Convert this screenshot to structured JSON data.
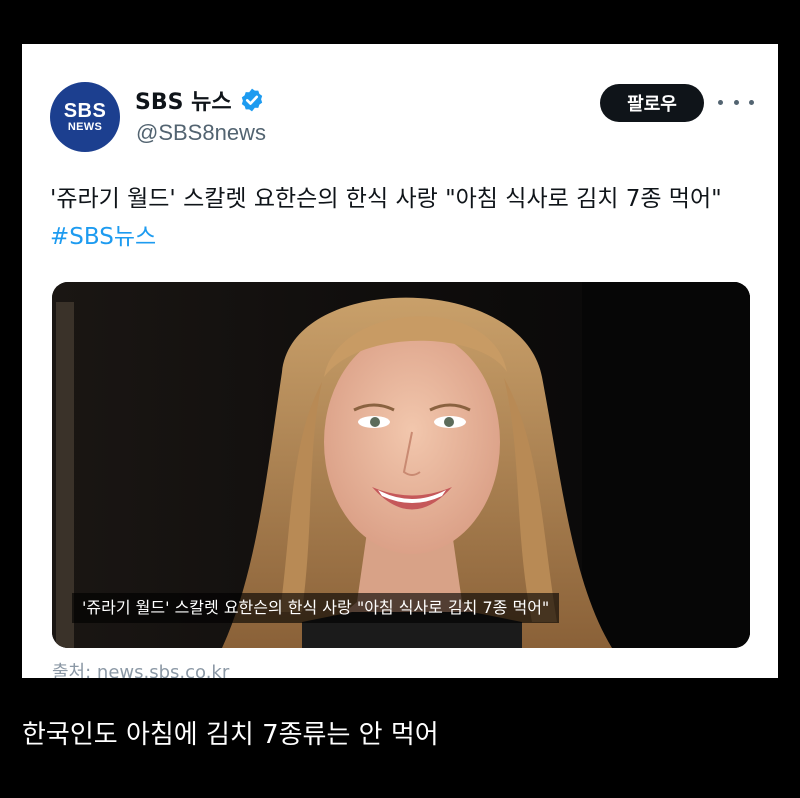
{
  "post": {
    "avatar_line1": "SBS",
    "avatar_line2": "NEWS",
    "account_name": "SBS 뉴스",
    "handle": "@SBS8news",
    "follow_label": "팔로우",
    "text": "'쥬라기 월드' 스칼렛 요한슨의 한식 사랑 \"아침 식사로 김치 7종 먹어\" ",
    "hashtag": "#SBS뉴스",
    "media_caption": "'쥬라기 월드' 스칼렛 요한슨의 한식 사랑 \"아침 식사로 김치 7종 먹어\"",
    "source": "출처: news.sbs.co.kr"
  },
  "comment": "한국인도 아침에 김치 7종류는 안 먹어",
  "colors": {
    "background": "#000000",
    "card": "#ffffff",
    "avatar": "#1c3f8f",
    "verified": "#1d9bf0",
    "hashtag": "#1d9bf0",
    "follow_button": "#0f1419"
  },
  "icons": {
    "verified": "verified-badge-icon",
    "more": "more-horizontal-icon"
  }
}
